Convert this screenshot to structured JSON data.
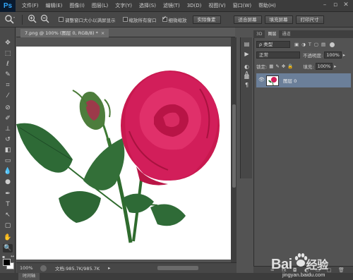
{
  "app": {
    "logo": "Ps",
    "menus": [
      "文件(F)",
      "编辑(E)",
      "图像(I)",
      "图层(L)",
      "文字(Y)",
      "选择(S)",
      "滤镜(T)",
      "3D(D)",
      "视图(V)",
      "窗口(W)",
      "帮助(H)"
    ],
    "window_controls": [
      "minimize-icon",
      "restore-icon",
      "close-icon"
    ]
  },
  "options_bar": {
    "tool_icon": "zoom-icon",
    "zoom_in_icon": "zoom-in-icon",
    "zoom_out_icon": "zoom-out-icon",
    "resize_windows_label": "调整窗口大小以满屏显示",
    "resize_windows_checked": false,
    "zoom_all_label": "缩放所有窗口",
    "zoom_all_checked": false,
    "scrubby_zoom_label": "细微缩放",
    "scrubby_zoom_checked": true,
    "btn_actual_pixels": "实际像素",
    "btn_fit_screen": "适合屏幕",
    "btn_fill_screen": "填充屏幕",
    "btn_print_size": "打印尺寸"
  },
  "document": {
    "tab_title": "7.png @ 100% (图层 0, RGB/8) *",
    "close": "×"
  },
  "status_bar": {
    "zoom": "100%",
    "doc_info": "文档:985.7K/985.7K",
    "arrow": "▸"
  },
  "bottom_panel": {
    "timeline_tab": "时间轴"
  },
  "colors": {
    "foreground": "#000000",
    "background": "#ffffff",
    "layer_selected": "#6b7f99",
    "rose": "#d21e5a",
    "leaf": "#2f6b3a"
  },
  "layers_panel": {
    "tabs": [
      "3D",
      "图层",
      "通道"
    ],
    "active_tab": "图层",
    "filter_kind": "ρ 类型",
    "blend_mode": "正常",
    "opacity_label": "不透明度:",
    "opacity_value": "100%",
    "lock_label": "锁定:",
    "fill_label": "填充:",
    "fill_value": "100%",
    "layers": [
      {
        "name": "图层 0",
        "visible": true,
        "selected": true
      }
    ],
    "footer_icons": [
      "link-icon",
      "fx-icon",
      "mask-icon",
      "adjustment-icon",
      "folder-icon",
      "new-layer-icon",
      "trash-icon"
    ]
  },
  "watermark": {
    "logo_text": "Bai",
    "logo_text2": "经验",
    "url": "jingyan.baidu.com"
  }
}
